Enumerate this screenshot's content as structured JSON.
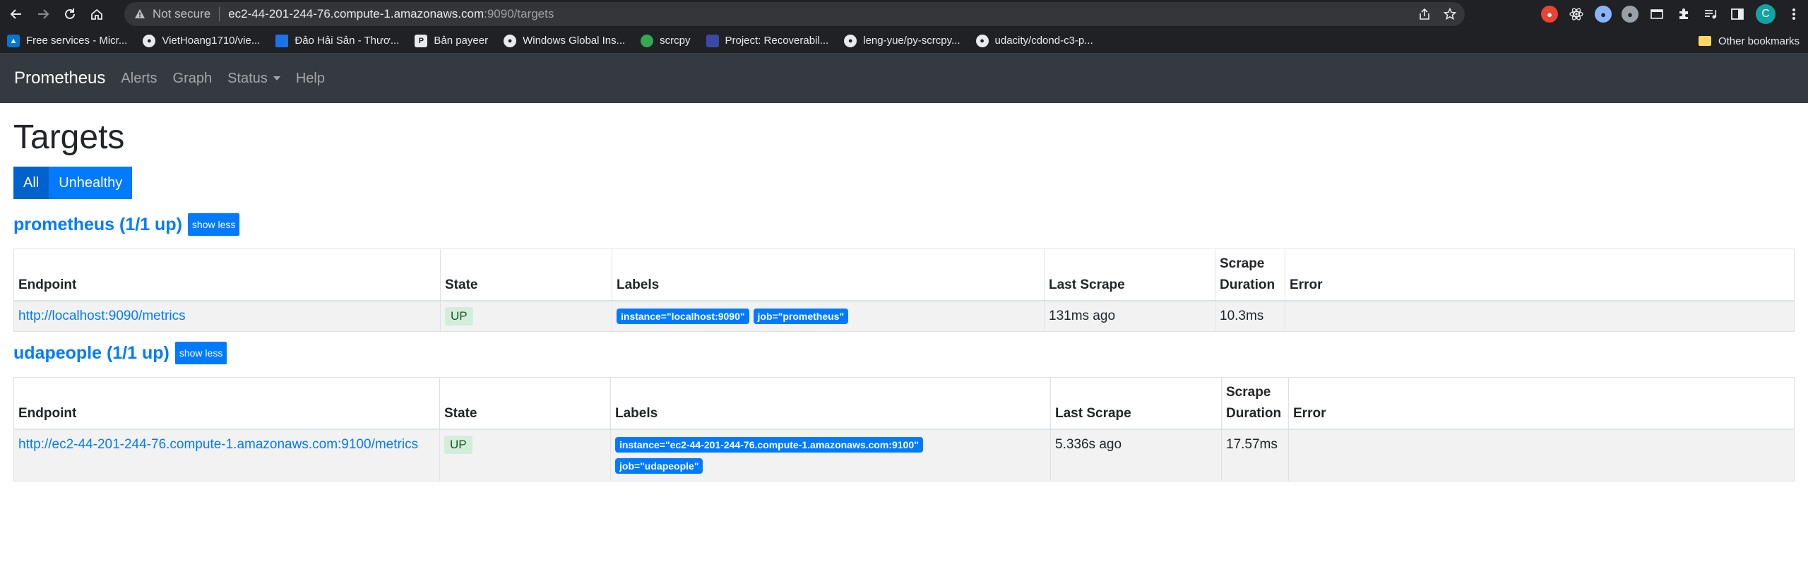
{
  "browser": {
    "not_secure": "Not secure",
    "host": "ec2-44-201-244-76.compute-1.amazonaws.com",
    "path": ":9090/targets",
    "profile_initial": "C",
    "bookmarks": [
      {
        "label": "Free services - Micr...",
        "icon": "microsoft-icon"
      },
      {
        "label": "VietHoang1710/vie...",
        "icon": "github-icon"
      },
      {
        "label": "Đảo Hải Sản - Thươ...",
        "icon": "flag-icon"
      },
      {
        "label": "Bản payeer",
        "icon": "payeer-icon"
      },
      {
        "label": "Windows Global Ins...",
        "icon": "github-icon"
      },
      {
        "label": "scrcpy",
        "icon": "scrcpy-icon"
      },
      {
        "label": "Project: Recoverabil...",
        "icon": "project-icon"
      },
      {
        "label": "leng-yue/py-scrcpy...",
        "icon": "github-icon"
      },
      {
        "label": "udacity/cdond-c3-p...",
        "icon": "github-icon"
      }
    ],
    "other_bookmarks": "Other bookmarks"
  },
  "navbar": {
    "brand": "Prometheus",
    "alerts": "Alerts",
    "graph": "Graph",
    "status": "Status",
    "help": "Help"
  },
  "page": {
    "title": "Targets",
    "filter_all": "All",
    "filter_unhealthy": "Unhealthy"
  },
  "columns": {
    "endpoint": "Endpoint",
    "state": "State",
    "labels": "Labels",
    "last_scrape": "Last Scrape",
    "scrape_duration_1": "Scrape",
    "scrape_duration_2": "Duration",
    "error": "Error"
  },
  "jobs": [
    {
      "title": "prometheus (1/1 up)",
      "toggle": "show less",
      "target": {
        "endpoint": "http://localhost:9090/metrics",
        "state": "UP",
        "labels": [
          "instance=\"localhost:9090\"",
          "job=\"prometheus\""
        ],
        "last_scrape": "131ms ago",
        "scrape_duration": "10.3ms",
        "error": ""
      }
    },
    {
      "title": "udapeople (1/1 up)",
      "toggle": "show less",
      "target": {
        "endpoint": "http://ec2-44-201-244-76.compute-1.amazonaws.com:9100/metrics",
        "state": "UP",
        "labels": [
          "instance=\"ec2-44-201-244-76.compute-1.amazonaws.com:9100\"",
          "job=\"udapeople\""
        ],
        "last_scrape": "5.336s ago",
        "scrape_duration": "17.57ms",
        "error": ""
      }
    }
  ]
}
